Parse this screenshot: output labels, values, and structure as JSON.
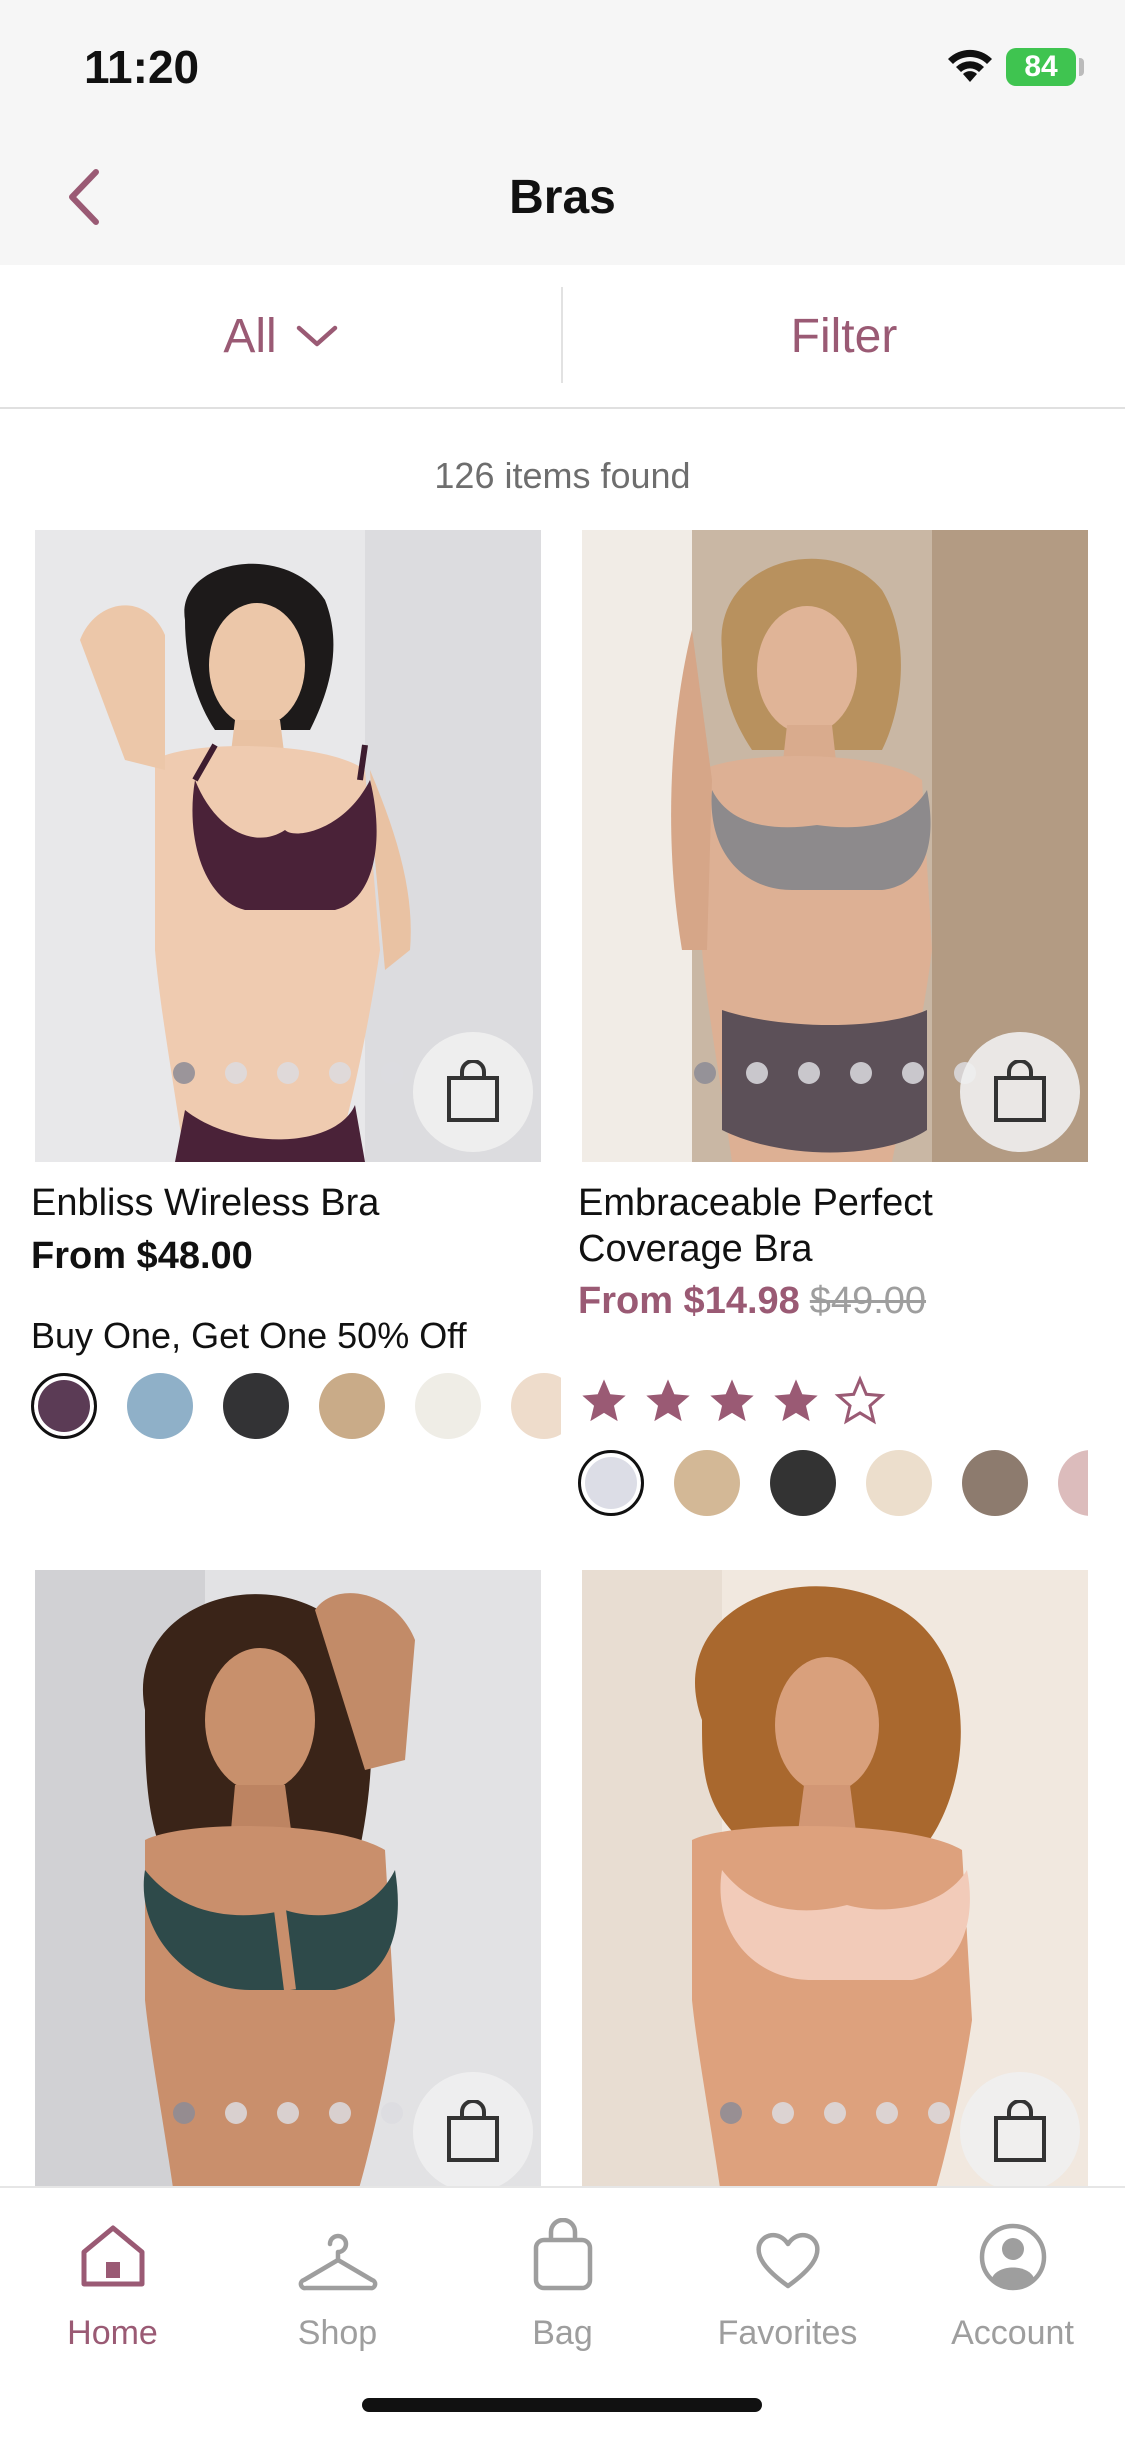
{
  "status": {
    "time": "11:20",
    "battery": "84"
  },
  "nav": {
    "title": "Bras"
  },
  "filters": {
    "all_label": "All",
    "filter_label": "Filter"
  },
  "results": {
    "count_text": "126 items found"
  },
  "products": [
    {
      "name": "Enbliss Wireless Bra",
      "price": "From $48.00",
      "promo": "Buy One, Get One 50% Off",
      "swatches": [
        "#5b3b55",
        "#8fb0c8",
        "#333335",
        "#c9ab88",
        "#efede6",
        "#eedccb"
      ]
    },
    {
      "name": "Embraceable Perfect Coverage Bra",
      "price": "From $14.98",
      "was_price": "$49.00",
      "rating": 4,
      "rating_max": 5,
      "swatches": [
        "#dcdde6",
        "#d3b896",
        "#333333",
        "#ecdecc",
        "#8d7b6e",
        "#dcbcbc"
      ]
    },
    {
      "name": "",
      "price": ""
    },
    {
      "name": "",
      "price": ""
    }
  ],
  "tabs": [
    {
      "label": "Home",
      "icon": "home-icon"
    },
    {
      "label": "Shop",
      "icon": "hanger-icon"
    },
    {
      "label": "Bag",
      "icon": "bag-icon"
    },
    {
      "label": "Favorites",
      "icon": "heart-icon"
    },
    {
      "label": "Account",
      "icon": "account-icon"
    }
  ],
  "colors": {
    "accent": "#9a5a74",
    "inactive": "#9e9e9e"
  }
}
